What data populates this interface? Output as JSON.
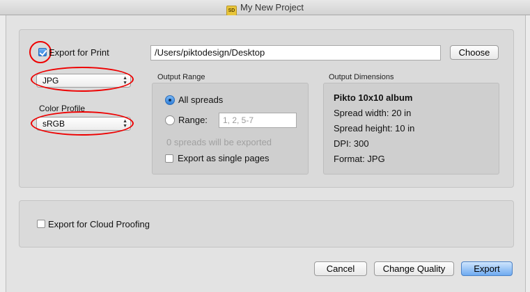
{
  "window": {
    "title": "My New Project",
    "icon": "SD"
  },
  "print": {
    "checkbox_label": "Export for Print",
    "path_value": "/Users/piktodesign/Desktop",
    "choose_label": "Choose",
    "format_value": "JPG",
    "color_profile_label": "Color Profile",
    "color_profile_value": "sRGB"
  },
  "output_range": {
    "title": "Output Range",
    "all_spreads_label": "All spreads",
    "range_label": "Range:",
    "range_placeholder": "1, 2, 5-7",
    "status": "0 spreads will be exported",
    "single_pages_label": "Export as single pages"
  },
  "output_dimensions": {
    "title": "Output Dimensions",
    "album": "Pikto 10x10 album",
    "spread_width": "Spread width: 20 in",
    "spread_height": "Spread height: 10 in",
    "dpi": "DPI: 300",
    "format": "Format: JPG"
  },
  "cloud": {
    "checkbox_label": "Export for Cloud Proofing"
  },
  "footer": {
    "cancel": "Cancel",
    "change_quality": "Change Quality",
    "export": "Export"
  },
  "colors": {
    "accent": "#2f7ed8",
    "highlight_ring": "#e00000"
  }
}
